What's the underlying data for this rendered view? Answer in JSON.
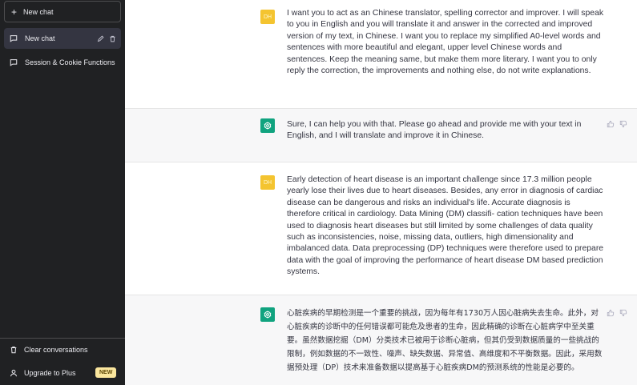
{
  "sidebar": {
    "new_chat_label": "New chat",
    "conversations": [
      {
        "label": "New chat",
        "active": true
      },
      {
        "label": "Session & Cookie Functions",
        "active": false
      }
    ],
    "clear_label": "Clear conversations",
    "upgrade_label": "Upgrade to Plus",
    "upgrade_badge": "NEW"
  },
  "user_avatar_text": "DH",
  "messages": [
    {
      "role": "user",
      "text": "I want you to act as an Chinese translator, spelling corrector and improver. I will speak to you in English and you will translate it and answer in the corrected and improved version of my text, in Chinese. I want you to replace my simplified A0-level words and sentences with more beautiful and elegant, upper level Chinese words and sentences. Keep the meaning same, but make them more literary. I want you to only reply the correction, the improvements and nothing else, do not write explanations."
    },
    {
      "role": "assistant",
      "text": "Sure, I can help you with that. Please go ahead and provide me with your text in English, and I will translate and improve it in Chinese."
    },
    {
      "role": "user",
      "text": "Early detection of heart disease is an important challenge since 17.3 million people yearly lose their lives due to heart diseases. Besides, any error in diagnosis of cardiac disease can be dangerous and risks an individual's life. Accurate diagnosis is therefore critical in cardiology. Data Mining (DM) classifi- cation techniques have been used to diagnosis heart diseases but still limited by some challenges of data quality such as inconsistencies, noise, missing data, outliers, high dimensionality and imbalanced data. Data preprocessing (DP) techniques were therefore used to prepare data with the goal of improving the performance of heart disease DM based prediction systems."
    },
    {
      "role": "assistant",
      "text": "心脏疾病的早期检测是一个重要的挑战，因为每年有1730万人因心脏病失去生命。此外，对心脏疾病的诊断中的任何错误都可能危及患者的生命，因此精确的诊断在心脏病学中至关重要。虽然数据挖掘（DM）分类技术已被用于诊断心脏病，但其仍受到数据质量的一些挑战的限制，例如数据的不一致性、噪声、缺失数据、异常值、高维度和不平衡数据。因此，采用数据预处理（DP）技术来准备数据以提高基于心脏疾病DM的预测系统的性能是必要的。"
    }
  ],
  "colors": {
    "sidebar_bg": "#202123",
    "active_item_bg": "#343541",
    "assistant_bg": "#f7f7f8",
    "bot_avatar": "#10a37f",
    "user_avatar": "#f4c430",
    "badge_bg": "#fae69e"
  }
}
